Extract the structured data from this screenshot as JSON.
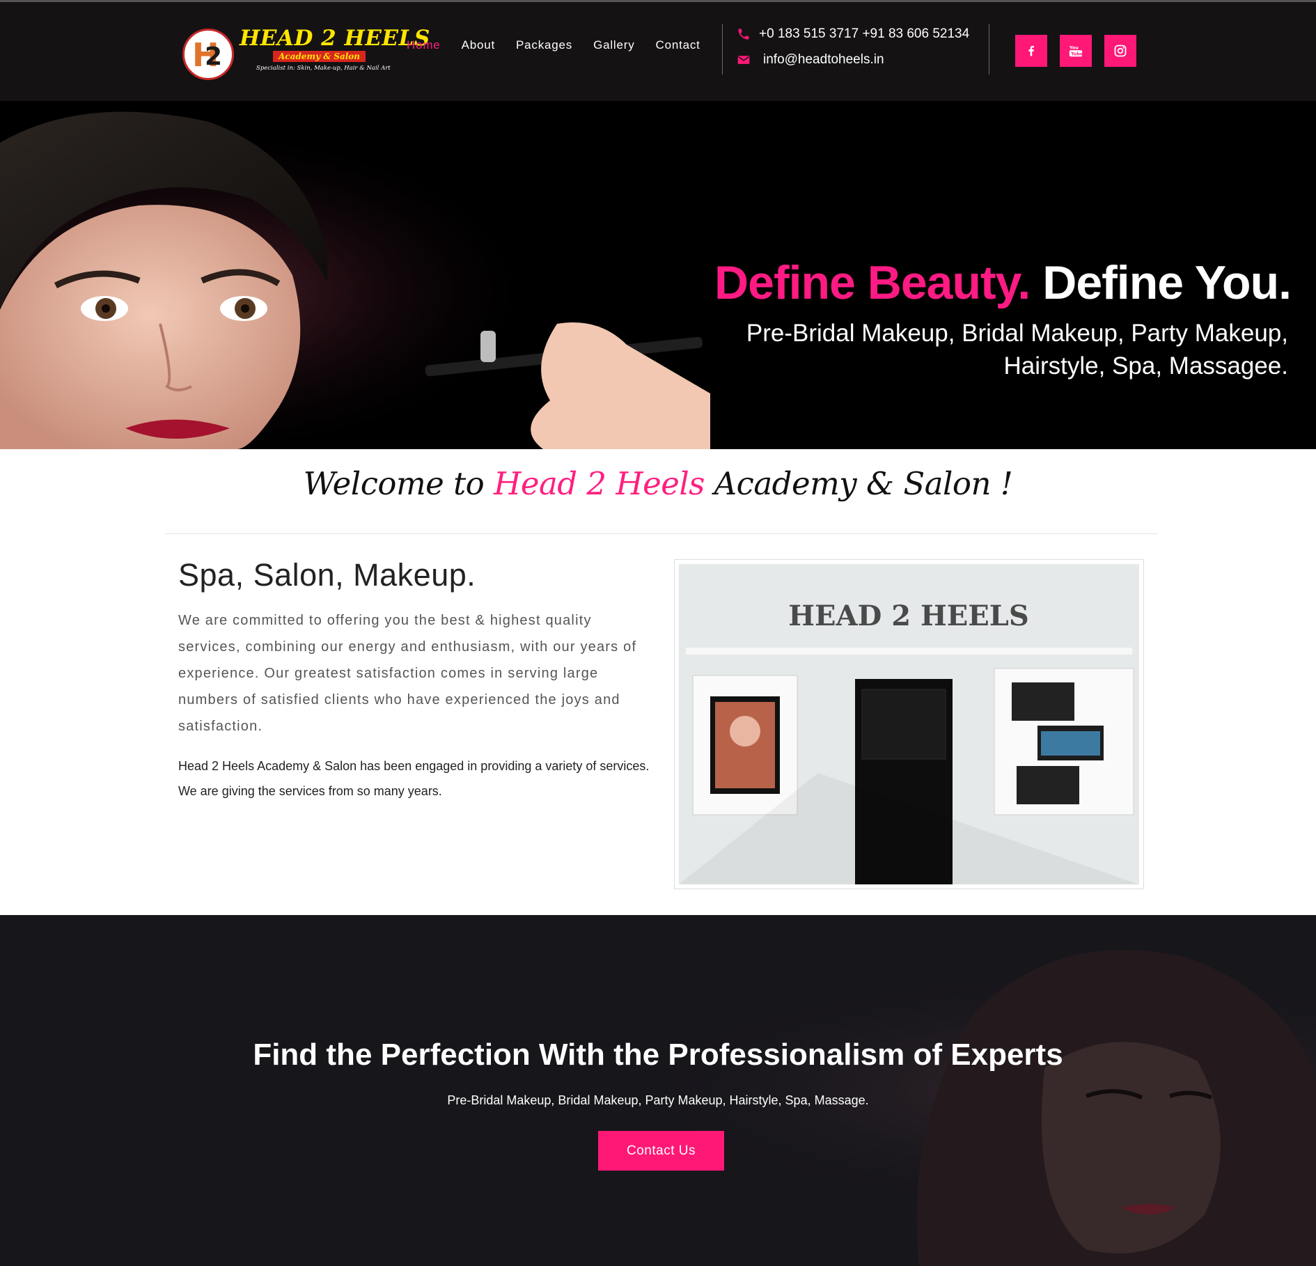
{
  "header": {
    "logo": {
      "title": "HEAD 2 HEELS",
      "subtitle": "Academy & Salon",
      "tagline": "Specialist in: Skin, Make-up, Hair & Nail Art"
    },
    "nav": [
      {
        "label": "Home",
        "active": true
      },
      {
        "label": "About",
        "active": false
      },
      {
        "label": "Packages",
        "active": false
      },
      {
        "label": "Gallery",
        "active": false
      },
      {
        "label": "Contact",
        "active": false
      }
    ],
    "phone": "+0 183 515 3717 +91 83 606 52134",
    "email": "info@headtoheels.in",
    "social": [
      {
        "icon": "facebook-icon"
      },
      {
        "icon": "youtube-icon"
      },
      {
        "icon": "instagram-icon"
      }
    ]
  },
  "hero": {
    "headline_pink": "Define Beauty.",
    "headline_white": "Define You.",
    "subline": "Pre-Bridal Makeup, Bridal Makeup, Party Makeup, Hairstyle, Spa, Massagee."
  },
  "welcome": {
    "prefix": "Welcome to ",
    "highlight": "Head 2 Heels",
    "suffix": " Academy & Salon !"
  },
  "about": {
    "heading": "Spa, Salon, Makeup.",
    "paragraph1": "We are committed to offering you the best & highest quality services, combining our energy and enthusiasm, with our years of experience. Our greatest satisfaction comes in serving large numbers of satisfied clients who have experienced the joys and satisfaction.",
    "paragraph2": "Head 2 Heels Academy & Salon has been engaged in providing a variety of services. We are giving the services from so many years.",
    "photo_sign": "HEAD 2 HEELS"
  },
  "cta": {
    "title": "Find the Perfection With the Professionalism of Experts",
    "subtitle": "Pre-Bridal Makeup, Bridal Makeup, Party Makeup, Hairstyle, Spa, Massage.",
    "button": "Contact Us"
  },
  "colors": {
    "accent": "#ff1876",
    "header_bg": "#141213",
    "cta_bg": "#17161b",
    "logo_yellow": "#ffe600"
  }
}
